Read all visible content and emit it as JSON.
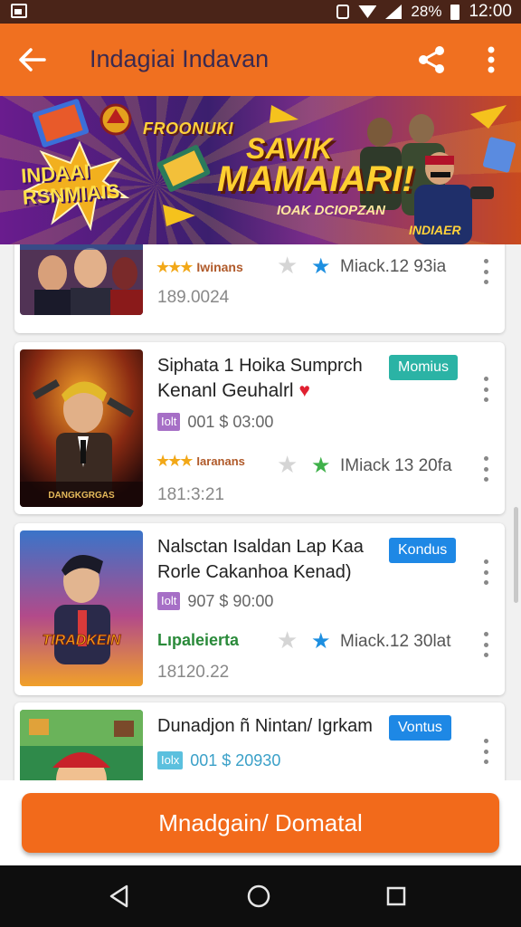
{
  "status_bar": {
    "battery": "28%",
    "time": "12:00"
  },
  "app_bar": {
    "title": "Indagiai Indavan"
  },
  "banner": {
    "headline_top": "FROONUKI",
    "badge_text": "INDAAI RSNMIAIS",
    "headline_1": "SAVIK",
    "headline_2": "MAMAIARI!",
    "subline": "IOAK DCIOPZAN",
    "corner_text": "INDIAER"
  },
  "cards": [
    {
      "title_1": "",
      "title_2": "",
      "badge": "",
      "price_tag": "",
      "price": "",
      "rating_text": "Iwinans",
      "meta": "Miack.12 93ia",
      "date": "189.0024"
    },
    {
      "title_1": "Siphata 1 Hoika Sumprch",
      "title_2": "Kenanl Geuhalrl ♥",
      "badge": "Momius",
      "price_tag": "Iolt",
      "price": "001 $ 03:00",
      "rating_text": "Iaranans",
      "meta": "IMiack 13 20fa",
      "date": "181:3:21"
    },
    {
      "title_1": "Nalsctan Isaldan Lap Kaa",
      "title_2": "Rorle Cakanhoa Kenad)",
      "badge": "Kondus",
      "price_tag": "Iolt",
      "price": "907 $ 90:00",
      "rating_text": "Lıpaleierta",
      "meta": "Miack.12 30lat",
      "date": "18120.22"
    },
    {
      "title_1": "Dunadjon ñ Nintan/ Igrkam",
      "title_2": "",
      "badge": "Vontus",
      "price_tag": "Iolx",
      "price": "001 $ 20930",
      "rating_text": "",
      "meta": "",
      "date": ""
    }
  ],
  "cta_label": "Mnadgain/ Domatal",
  "colors": {
    "app_bar": "#f07020",
    "cta": "#f26a1b",
    "badge_teal": "#2bb3a5",
    "badge_blue": "#1e88e5",
    "price_tag": "#a66fc6",
    "price_tag_blue": "#5bc0de"
  }
}
